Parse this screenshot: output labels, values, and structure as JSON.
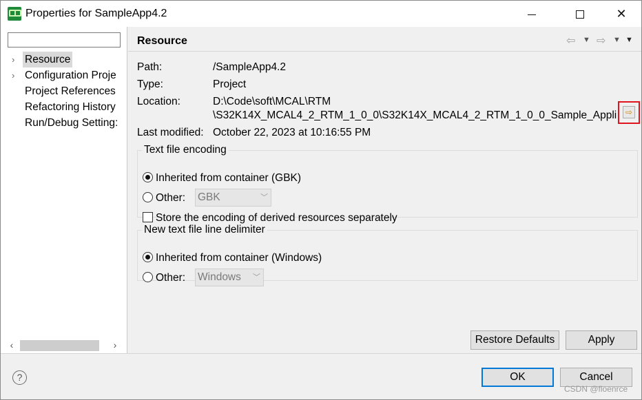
{
  "window": {
    "title": "Properties for SampleApp4.2",
    "minimize": "minimize",
    "maximize": "maximize",
    "close": "✕"
  },
  "sidebar": {
    "filter_value": "",
    "items": [
      {
        "label": "Resource",
        "expandable": true,
        "selected": true
      },
      {
        "label": "Configuration Proje",
        "expandable": true,
        "selected": false
      },
      {
        "label": "Project References",
        "expandable": false,
        "selected": false
      },
      {
        "label": "Refactoring History",
        "expandable": false,
        "selected": false
      },
      {
        "label": "Run/Debug Setting:",
        "expandable": false,
        "selected": false
      }
    ]
  },
  "page": {
    "title": "Resource",
    "path_label": "Path:",
    "path_value": "/SampleApp4.2",
    "type_label": "Type:",
    "type_value": "Project",
    "location_label": "Location:",
    "location_line1": "D:\\Code\\soft\\MCAL\\RTM",
    "location_line2": "\\S32K14X_MCAL4_2_RTM_1_0_0\\S32K14X_MCAL4_2_RTM_1_0_0_Sample_Appli",
    "modified_label": "Last modified:",
    "modified_value": "October 22, 2023 at 10:16:55 PM"
  },
  "encoding": {
    "title": "Text file encoding",
    "inherited_label": "Inherited from container (GBK)",
    "other_label": "Other:",
    "other_value": "GBK",
    "store_label": "Store the encoding of derived resources separately"
  },
  "delimiter": {
    "title": "New text file line delimiter",
    "inherited_label": "Inherited from container (Windows)",
    "other_label": "Other:",
    "other_value": "Windows"
  },
  "buttons": {
    "restore_defaults": "Restore Defaults",
    "apply": "Apply",
    "ok": "OK",
    "cancel": "Cancel"
  },
  "icons": {
    "help": "?",
    "nav_back": "⇦",
    "nav_forward": "⇨",
    "dropdown": "▼",
    "tree_expand": "›"
  },
  "watermark": "CSDN @floenrce",
  "colors": {
    "highlight_box": "#e0141e",
    "default_button_border": "#0078d7",
    "app_icon": "#1f8a3a"
  }
}
